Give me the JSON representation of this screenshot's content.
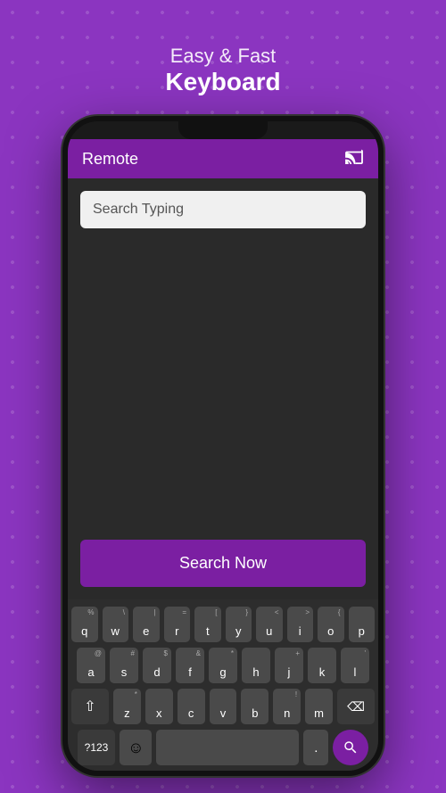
{
  "page": {
    "background_color": "#8b35c0",
    "header": {
      "subtitle": "Easy & Fast",
      "title": "Keyboard"
    }
  },
  "phone": {
    "app_bar": {
      "title": "Remote",
      "cast_icon": "⬡"
    },
    "search_input": {
      "placeholder": "Search Typing"
    },
    "search_button": {
      "label": "Search Now"
    }
  },
  "keyboard": {
    "rows": [
      [
        {
          "label": "q",
          "top": "%"
        },
        {
          "label": "w",
          "top": "\\"
        },
        {
          "label": "e",
          "top": "|"
        },
        {
          "label": "r",
          "top": "="
        },
        {
          "label": "t",
          "top": "["
        },
        {
          "label": "y",
          "top": "}"
        },
        {
          "label": "u",
          "top": "<"
        },
        {
          "label": "i",
          "top": ">"
        },
        {
          "label": "o",
          "top": "{"
        },
        {
          "label": "p",
          "top": ""
        }
      ],
      [
        {
          "label": "a",
          "top": "@"
        },
        {
          "label": "s",
          "top": "#"
        },
        {
          "label": "d",
          "top": "$"
        },
        {
          "label": "f",
          "top": "&"
        },
        {
          "label": "g",
          "top": "*"
        },
        {
          "label": "h",
          "top": ""
        },
        {
          "label": "j",
          "top": "+"
        },
        {
          "label": "k",
          "top": ""
        },
        {
          "label": "l",
          "top": "'"
        }
      ],
      [
        {
          "label": "z",
          "top": "*"
        },
        {
          "label": "x",
          "top": ""
        },
        {
          "label": "c",
          "top": ""
        },
        {
          "label": "v",
          "top": ""
        },
        {
          "label": "b",
          "top": ""
        },
        {
          "label": "n",
          "top": "!"
        },
        {
          "label": "m",
          "top": ""
        }
      ]
    ],
    "bottom": {
      "num_label": "?123",
      "comma": ",",
      "period": ".",
      "search_icon": "🔍"
    }
  }
}
